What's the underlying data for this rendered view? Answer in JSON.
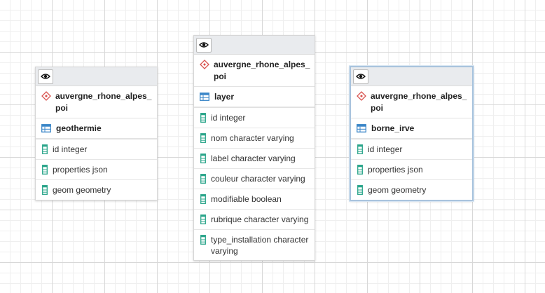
{
  "nodes": [
    {
      "schema": "auvergne_rhone_alpes_poi",
      "table": "geothermie",
      "selected": false,
      "columns": [
        "id integer",
        "properties json",
        "geom geometry"
      ]
    },
    {
      "schema": "auvergne_rhone_alpes_poi",
      "table": "layer",
      "selected": false,
      "columns": [
        "id integer",
        "nom character varying",
        "label character varying",
        "couleur character varying",
        "modifiable boolean",
        "rubrique character varying",
        "type_installation character varying"
      ]
    },
    {
      "schema": "auvergne_rhone_alpes_poi",
      "table": "borne_irve",
      "selected": true,
      "columns": [
        "id integer",
        "properties json",
        "geom geometry"
      ]
    }
  ],
  "icons": {
    "toggle": "eye-icon",
    "schema": "schema-diamond-icon",
    "table": "table-icon",
    "column": "column-icon"
  },
  "colors": {
    "schema_icon": "#d9534f",
    "table_icon": "#3a86c8",
    "column_icon": "#2aa58a",
    "selection": "#a8c3dd"
  }
}
